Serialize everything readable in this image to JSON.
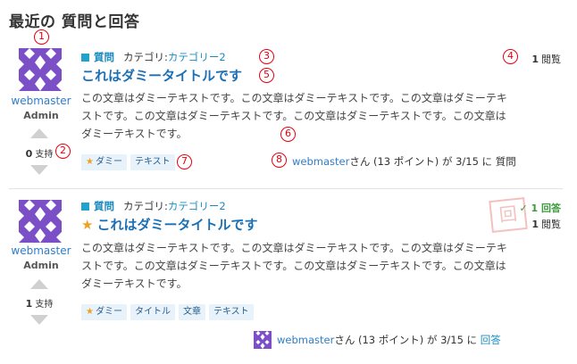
{
  "page": {
    "title": "最近の 質問と回答"
  },
  "markers": [
    "1",
    "2",
    "3",
    "4",
    "5",
    "6",
    "7",
    "8"
  ],
  "questions": [
    {
      "type_label": "質問",
      "category_prefix": "カテゴリ: ",
      "category": "カテゴリー2",
      "title": "これはダミータイトルです",
      "body": "この文章はダミーテキストです。この文章はダミーテキストです。この文章はダミーテキストです。この文章はダミーテキストです。この文章はダミーテキストです。この文章はダミーテキストです。",
      "user": "webmaster",
      "role": "Admin",
      "votes": "0",
      "votes_label": "支持",
      "views": "1",
      "views_label": "閲覧",
      "tags": [
        "ダミー",
        "テキスト"
      ],
      "footer": {
        "user": "webmaster",
        "suffix": "さん (13 ポイント) が 3/15 に",
        "action": "質問"
      }
    },
    {
      "type_label": "質問",
      "category_prefix": "カテゴリ: ",
      "category": "カテゴリー2",
      "title": "これはダミータイトルです",
      "body": "この文章はダミーテキストです。この文章はダミーテキストです。この文章はダミーテキストです。この文章はダミーテキストです。この文章はダミーテキストです。この文章はダミーテキストです。",
      "user": "webmaster",
      "role": "Admin",
      "votes": "1",
      "votes_label": "支持",
      "answers": "✓ 1 回答",
      "views": "1",
      "views_label": "閲覧",
      "stamp": "回",
      "tags": [
        "ダミー",
        "タイトル",
        "文章",
        "テキスト"
      ],
      "footer": {
        "user": "webmaster",
        "suffix": "さん (13 ポイント) が 3/15 に",
        "action": "回答"
      }
    }
  ],
  "colors": {
    "link": "#1a6fb5",
    "accent": "#1fa3c8",
    "marker": "#e60012",
    "star": "#f0a020",
    "avatar": "#7b4fc6"
  },
  "icons": [
    "star-icon",
    "vote-up-arrow-icon",
    "vote-down-arrow-icon",
    "identicon-avatar",
    "check-icon"
  ]
}
